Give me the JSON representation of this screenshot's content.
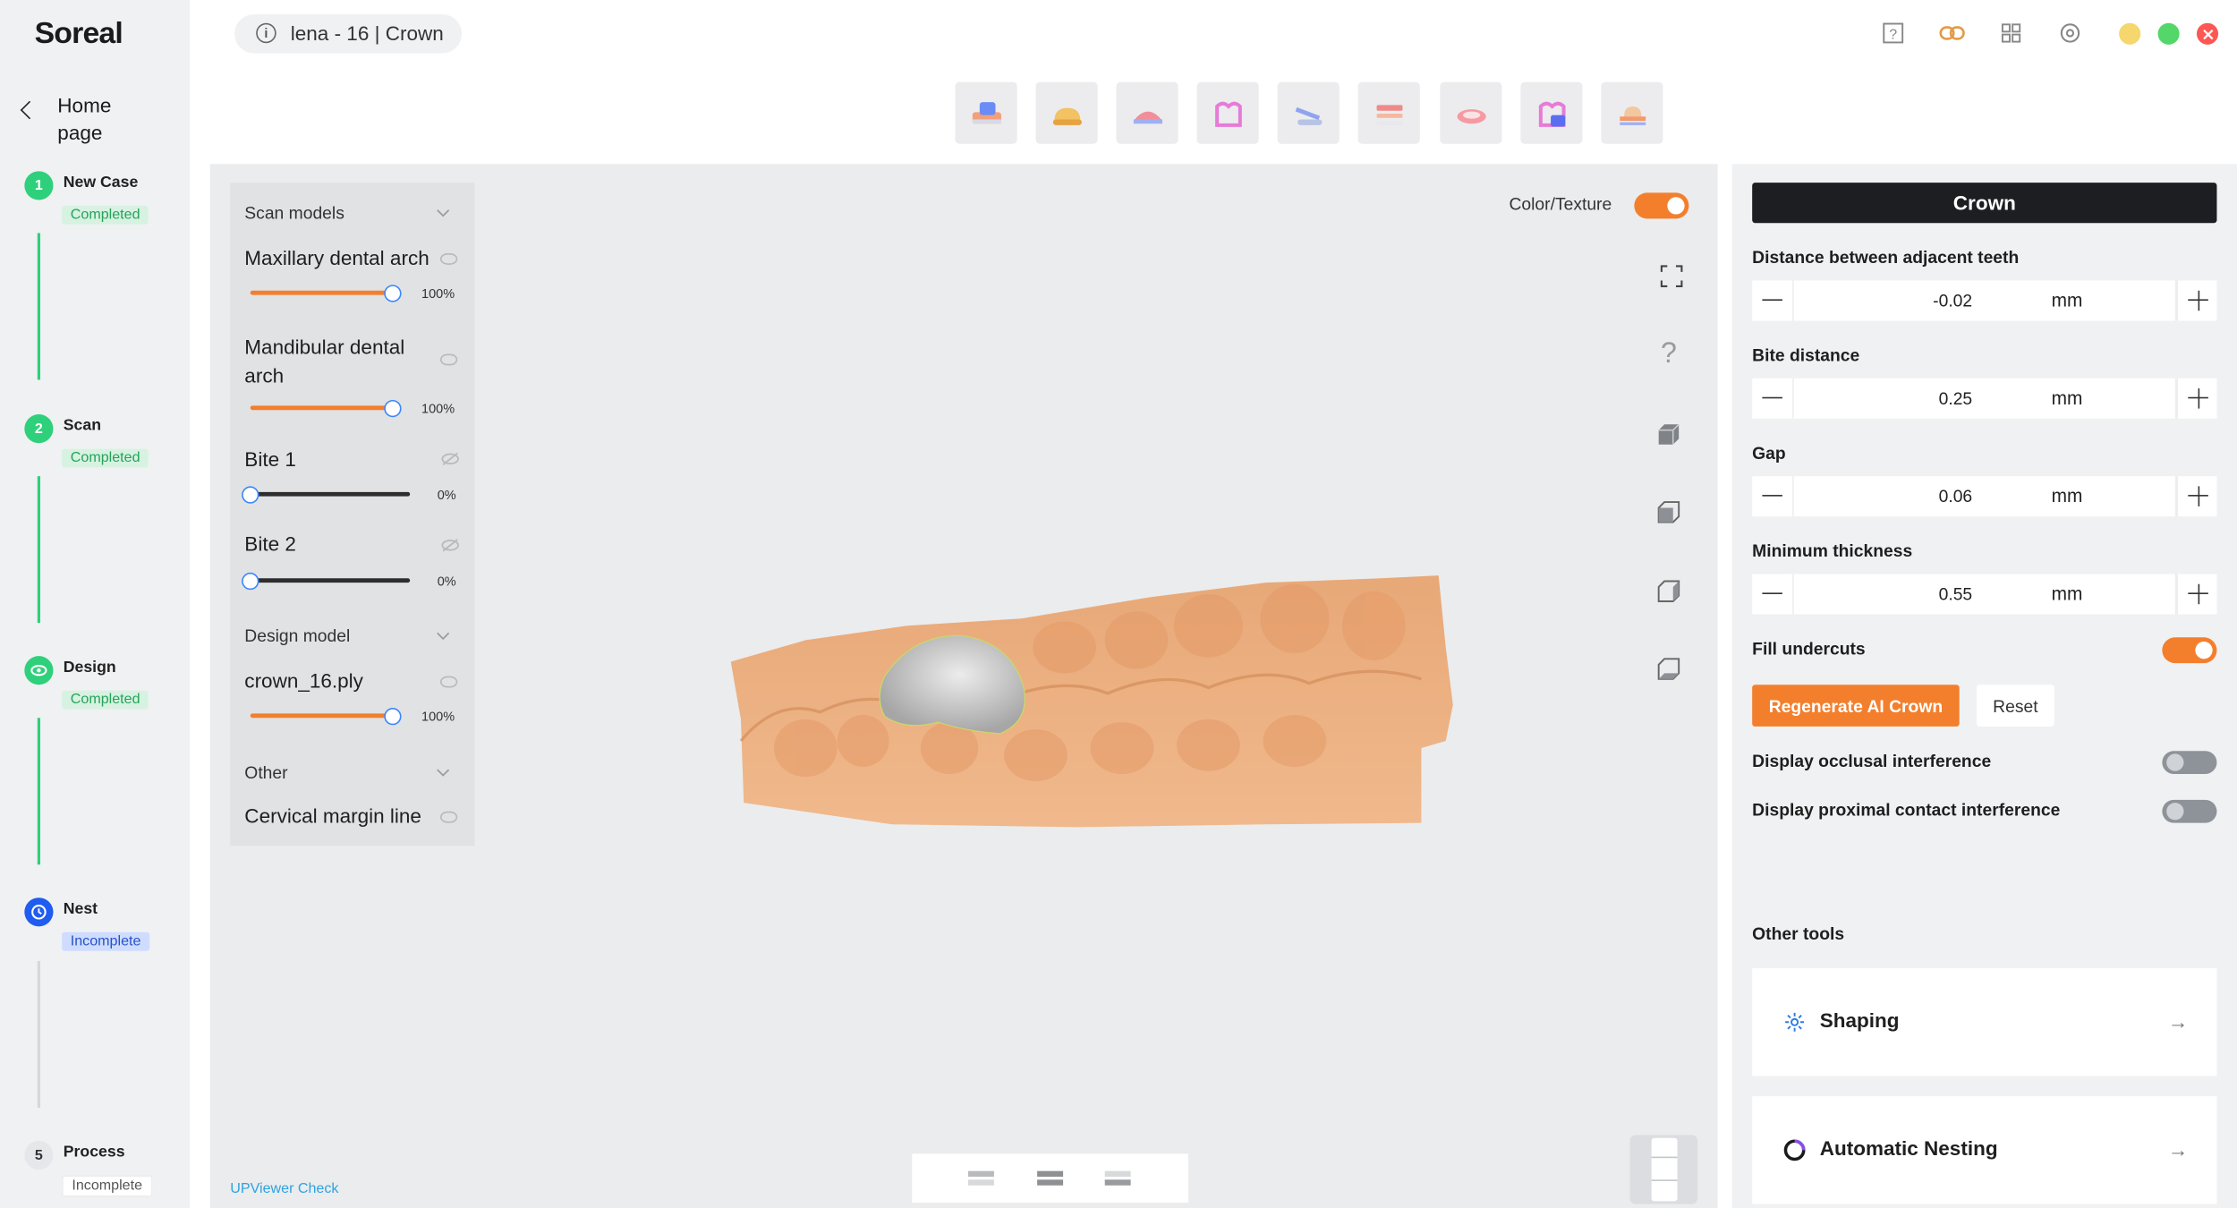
{
  "app": {
    "logo": "Soreal"
  },
  "nav": {
    "back_label": "Home page"
  },
  "steps": [
    {
      "num": "1",
      "title": "New Case",
      "status": "Completed"
    },
    {
      "num": "2",
      "title": "Scan",
      "status": "Completed"
    },
    {
      "num": "",
      "title": "Design",
      "status": "Completed"
    },
    {
      "num": "",
      "title": "Nest",
      "status": "Incomplete"
    },
    {
      "num": "5",
      "title": "Process",
      "status": "Incomplete"
    }
  ],
  "case": {
    "label": "lena - 16 | Crown",
    "info_glyph": "i"
  },
  "toolbar": {
    "tools": [
      "scan-tool-icon",
      "crown-tool-icon",
      "bridge-tool-icon",
      "coping-tool-icon",
      "denture-tool-icon",
      "layers-tool-icon",
      "gingiva-tool-icon",
      "ai-tool-icon",
      "model-tool-icon"
    ]
  },
  "window": {
    "top_icons": [
      "help-icon",
      "link-icon",
      "grid-icon",
      "settings-icon"
    ],
    "colors": {
      "min": "#f5d76e",
      "max": "#53d769",
      "close": "#fc5753"
    }
  },
  "layers": {
    "scan_models": "Scan models",
    "items": [
      {
        "name": "Maxillary dental arch",
        "pct": "100%",
        "level": 1.0,
        "visible": true
      },
      {
        "name": "Mandibular dental arch",
        "pct": "100%",
        "level": 1.0,
        "visible": true
      },
      {
        "name": "Bite 1",
        "pct": "0%",
        "level": 0.0,
        "visible": false
      },
      {
        "name": "Bite 2",
        "pct": "0%",
        "level": 0.0,
        "visible": false
      }
    ],
    "design_model": "Design model",
    "design_items": [
      {
        "name": "crown_16.ply",
        "pct": "100%",
        "level": 1.0
      }
    ],
    "other": "Other",
    "other_items": [
      {
        "name": "Cervical margin line"
      }
    ]
  },
  "viewport": {
    "color_texture_label": "Color/Texture",
    "color_texture_on": true,
    "footer_link": "UPViewer Check",
    "help_glyph": "?"
  },
  "panel": {
    "title": "Crown",
    "params": [
      {
        "label": "Distance between adjacent teeth",
        "value": "-0.02",
        "unit": "mm"
      },
      {
        "label": "Bite distance",
        "value": "0.25",
        "unit": "mm"
      },
      {
        "label": "Gap",
        "value": "0.06",
        "unit": "mm"
      },
      {
        "label": "Minimum thickness",
        "value": "0.55",
        "unit": "mm"
      }
    ],
    "fill_undercuts": "Fill undercuts",
    "fill_undercuts_on": true,
    "regen_label": "Regenerate AI Crown",
    "reset_label": "Reset",
    "occlusal": "Display occlusal interference",
    "proximal": "Display proximal contact interference",
    "other_tools": "Other tools",
    "tools": [
      {
        "name": "Shaping",
        "icon": "shaping-icon",
        "arrow": "→"
      },
      {
        "name": "Automatic Nesting",
        "icon": "nesting-icon",
        "arrow": "→"
      }
    ]
  },
  "colors": {
    "accent": "#f37f2d",
    "completed": "#2fd07b",
    "active": "#1f5cf0",
    "link": "#2da3e0"
  }
}
